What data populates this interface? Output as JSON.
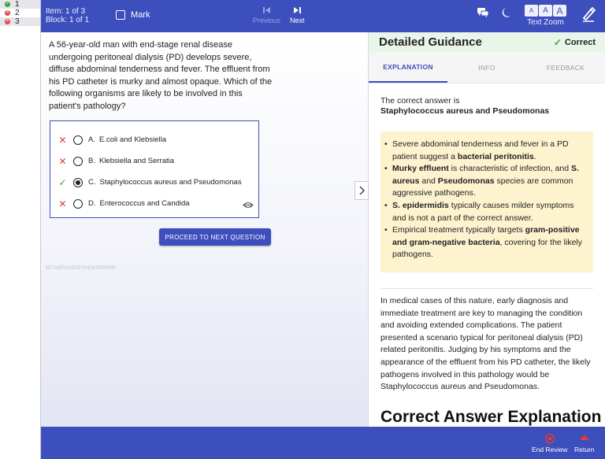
{
  "question_list": [
    {
      "num": "1",
      "status": "correct"
    },
    {
      "num": "2",
      "status": "incorrect"
    },
    {
      "num": "3",
      "status": "incorrect"
    }
  ],
  "topbar": {
    "item_info": "Item: 1 of 3",
    "block_info": "Block: 1 of 1",
    "mark_label": "Mark",
    "previous_label": "Previous",
    "next_label": "Next",
    "zoom_buttons": [
      "A",
      "A",
      "A"
    ],
    "zoom_label": "Text Zoom",
    "icons": [
      "chat-icon",
      "moon-icon",
      "pen-icon"
    ]
  },
  "question": {
    "text": "A 56-year-old man with end-stage renal disease undergoing peritoneal dialysis (PD) develops severe, diffuse abdominal tenderness and fever. The effluent from his PD catheter is murky and almost opaque. Which of the following organisms are likely to be involved in this patient's pathology?",
    "answers": [
      {
        "letter": "A.",
        "text": "E.coli and Klebsiella",
        "result": "incorrect",
        "selected": false
      },
      {
        "letter": "B.",
        "text": "Klebsiella and Serratia",
        "result": "incorrect",
        "selected": false
      },
      {
        "letter": "C.",
        "text": "Staphylococcus aureus and Pseudomonas",
        "result": "correct",
        "selected": true
      },
      {
        "letter": "D.",
        "text": "Enterococcus and Candida",
        "result": "incorrect",
        "selected": false
      }
    ],
    "proceed_label": "PROCEED TO NEXT QUESTION",
    "hash_id": "807a9f1ecb387e43e5066fd5"
  },
  "guidance": {
    "title": "Detailed Guidance",
    "status": "Correct",
    "tabs": [
      "EXPLANATION",
      "INFO",
      "FEEDBACK"
    ],
    "active_tab": "EXPLANATION",
    "intro": "The correct answer is",
    "correct_answer": "Staphylococcus aureus and Pseudomonas",
    "bullets": [
      [
        {
          "t": "Severe abdominal tenderness and fever in a PD patient suggest a "
        },
        {
          "t": "bacterial peritonitis",
          "b": true
        },
        {
          "t": "."
        }
      ],
      [
        {
          "t": "Murky effluent",
          "b": true
        },
        {
          "t": " is characteristic of infection, and "
        },
        {
          "t": "S. aureus",
          "b": true
        },
        {
          "t": " and "
        },
        {
          "t": "Pseudomonas",
          "b": true
        },
        {
          "t": " species are common aggressive pathogens."
        }
      ],
      [
        {
          "t": "S. epidermidis",
          "b": true
        },
        {
          "t": " typically causes milder symptoms and is not a part of the correct answer."
        }
      ],
      [
        {
          "t": "Empirical treatment typically targets "
        },
        {
          "t": "gram-positive and gram-negative bacteria",
          "b": true
        },
        {
          "t": ", covering for the likely pathogens."
        }
      ]
    ],
    "paragraph": "In medical cases of this nature, early diagnosis and immediate treatment are key to managing the condition and avoiding extended complications. The patient presented a scenario typical for peritoneal dialysis (PD) related peritonitis. Judging by his symptoms and the appearance of the effluent from his PD catheter, the likely pathogens involved in this pathology would be Staphylococcus aureus and Pseudomonas.",
    "section_heading": "Correct Answer Explanation"
  },
  "bottombar": {
    "end_review_label": "End Review",
    "return_label": "Return"
  },
  "colors": {
    "primary": "#3d4ebd",
    "correct": "#38a53a",
    "incorrect": "#e03a3a",
    "note_bg": "#fdf3cf",
    "guide_header_bg": "#e8f5e8"
  }
}
